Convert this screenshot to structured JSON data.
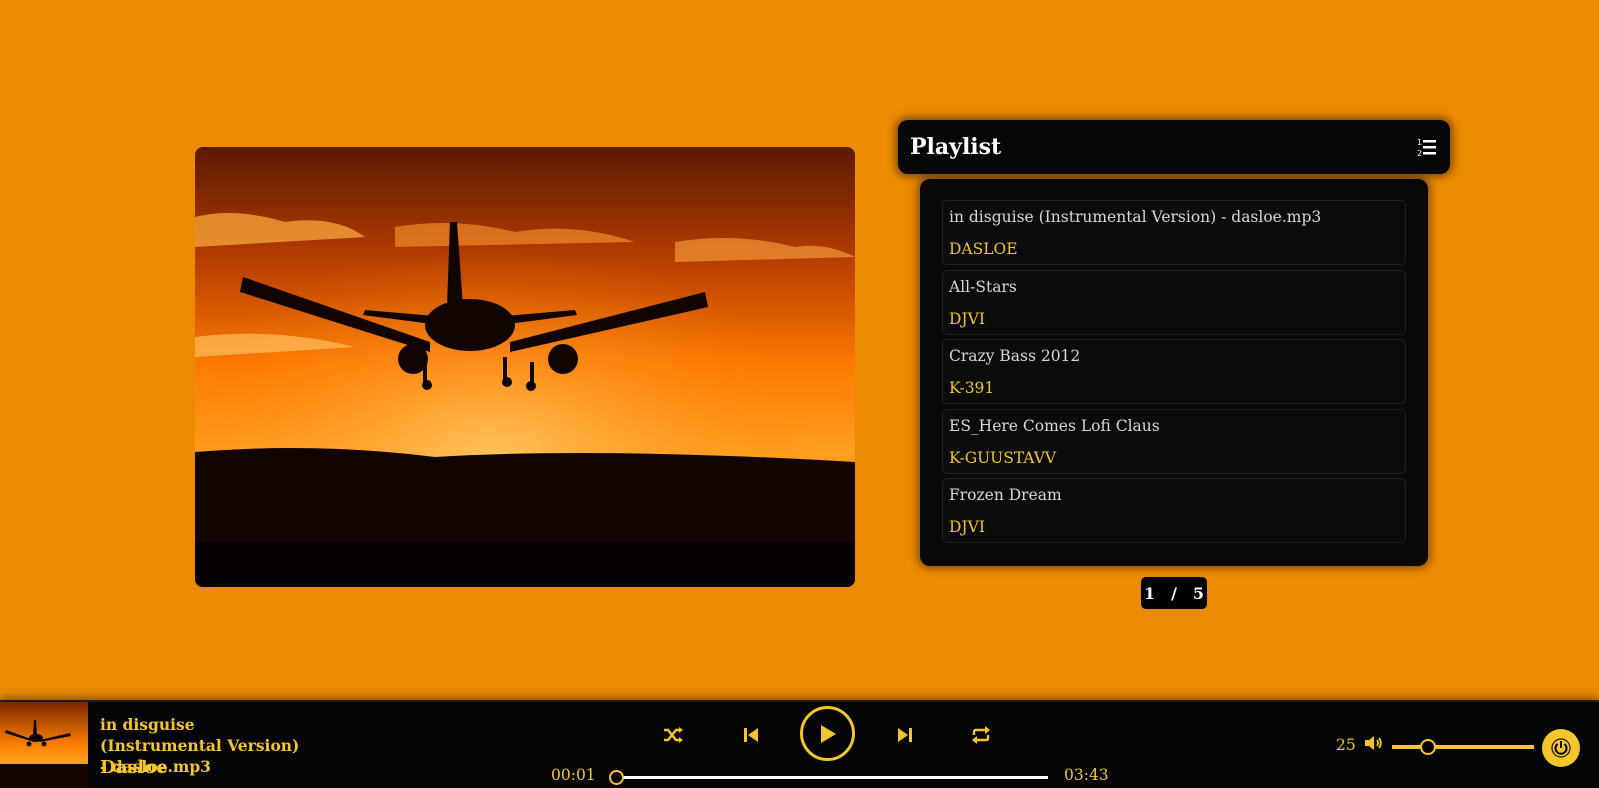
{
  "playlist": {
    "title": "Playlist",
    "header_icon": "list-ordered-icon",
    "tracks": [
      {
        "title": "in disguise (Instrumental Version) - dasloe.mp3",
        "artist": "DASLOE"
      },
      {
        "title": "All-Stars",
        "artist": "DJVI"
      },
      {
        "title": "Crazy Bass 2012",
        "artist": "K-391"
      },
      {
        "title": "ES_Here Comes Lofi Claus",
        "artist": "K-GUUSTAVV"
      },
      {
        "title": "Frozen Dream",
        "artist": "DJVI"
      }
    ],
    "pagination": {
      "current": "1",
      "separator": "/",
      "total": "5"
    }
  },
  "now_playing": {
    "title": "in disguise (Instrumental Version) - dasloe.mp3",
    "artist": "Dasloe",
    "current_time": "00:01",
    "duration": "03:43",
    "progress_fraction": 0.005
  },
  "controls": {
    "icons": [
      "shuffle-icon",
      "previous-icon",
      "play-icon",
      "next-icon",
      "repeat-icon",
      "volume-icon",
      "power-icon"
    ]
  },
  "volume": {
    "value": "25",
    "fraction": 0.25
  },
  "colors": {
    "background": "#ec8a00",
    "accent": "#f4c62a",
    "panel": "#060606"
  }
}
